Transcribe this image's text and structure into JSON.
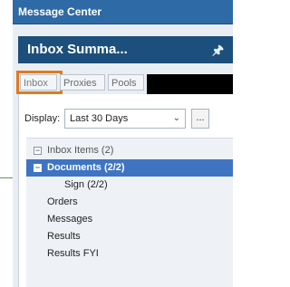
{
  "window": {
    "title": "Message Center"
  },
  "pane": {
    "title": "Inbox Summa...",
    "pin_icon": "pin-icon"
  },
  "tabs": [
    {
      "label": "Inbox",
      "active": true
    },
    {
      "label": "Proxies",
      "active": false
    },
    {
      "label": "Pools",
      "active": false
    }
  ],
  "display": {
    "label": "Display:",
    "selected": "Last 30 Days",
    "more_label": "..."
  },
  "tree": {
    "group": {
      "label": "Inbox Items (2)",
      "expanded": true
    },
    "items": [
      {
        "label": "Documents (2/2)",
        "selected": true,
        "expander": "−"
      },
      {
        "label": "Sign (2/2)"
      },
      {
        "label": "Orders"
      },
      {
        "label": "Messages"
      },
      {
        "label": "Results"
      },
      {
        "label": "Results FYI"
      }
    ]
  },
  "colors": {
    "title_bar": "#2e6aa6",
    "pane_header": "#1c4f7c",
    "highlight": "#e07a1f",
    "selection": "#3f74c3"
  }
}
